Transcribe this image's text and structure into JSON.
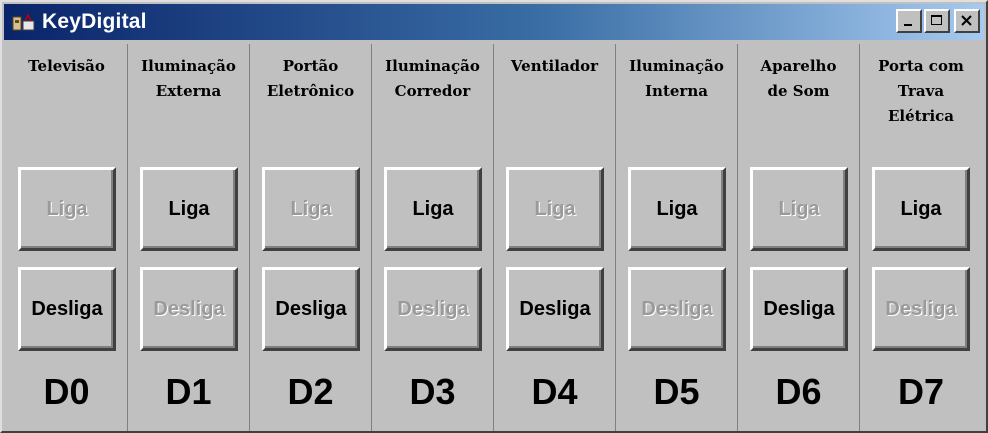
{
  "window": {
    "title": "KeyDigital"
  },
  "devices": [
    {
      "label": "Televisão",
      "on_label": "Liga",
      "off_label": "Desliga",
      "on_enabled": false,
      "off_enabled": true,
      "code": "D0"
    },
    {
      "label": "Iluminação\nExterna",
      "on_label": "Liga",
      "off_label": "Desliga",
      "on_enabled": true,
      "off_enabled": false,
      "code": "D1"
    },
    {
      "label": "Portão\nEletrônico",
      "on_label": "Liga",
      "off_label": "Desliga",
      "on_enabled": false,
      "off_enabled": true,
      "code": "D2"
    },
    {
      "label": "Iluminação\nCorredor",
      "on_label": "Liga",
      "off_label": "Desliga",
      "on_enabled": true,
      "off_enabled": false,
      "code": "D3"
    },
    {
      "label": "Ventilador",
      "on_label": "Liga",
      "off_label": "Desliga",
      "on_enabled": false,
      "off_enabled": true,
      "code": "D4"
    },
    {
      "label": "Iluminação\nInterna",
      "on_label": "Liga",
      "off_label": "Desliga",
      "on_enabled": true,
      "off_enabled": false,
      "code": "D5"
    },
    {
      "label": "Aparelho\nde Som",
      "on_label": "Liga",
      "off_label": "Desliga",
      "on_enabled": false,
      "off_enabled": true,
      "code": "D6"
    },
    {
      "label": "Porta com\nTrava\nElétrica",
      "on_label": "Liga",
      "off_label": "Desliga",
      "on_enabled": true,
      "off_enabled": false,
      "code": "D7"
    }
  ]
}
